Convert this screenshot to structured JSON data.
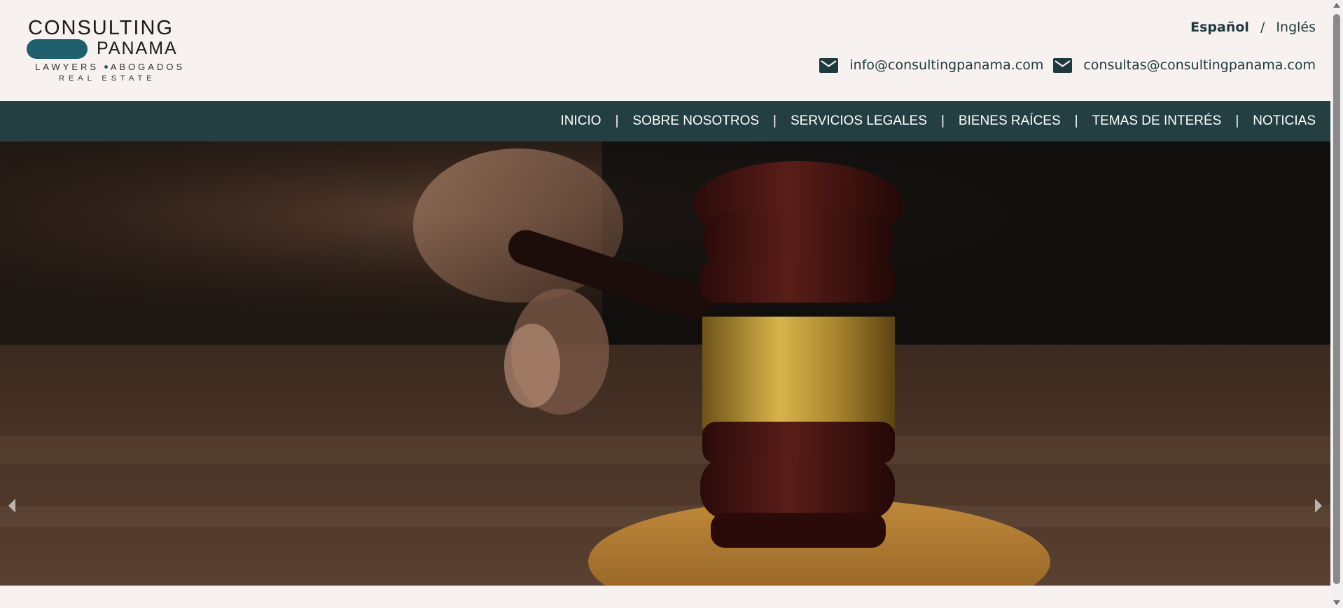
{
  "logo": {
    "line1": "CONSULTING",
    "line2": "PANAMA",
    "tagline_left": "LAWYERS",
    "tagline_right": "ABOGADOS",
    "line3": "REAL ESTATE"
  },
  "language": {
    "spanish": "Español",
    "separator": "/",
    "english": "Inglés"
  },
  "contacts": [
    {
      "icon": "mail-icon",
      "email": "info@consultingpanama.com"
    },
    {
      "icon": "mail-icon",
      "email": "consultas@consultingpanama.com"
    }
  ],
  "nav": {
    "items": [
      "INICIO",
      "SOBRE NOSOTROS",
      "SERVICIOS LEGALES",
      "BIENES RAÍCES",
      "TEMAS DE INTERÉS",
      "NOTICIAS"
    ],
    "separator": "|"
  },
  "hero": {
    "image": "judge-gavel-photo",
    "prev_icon": "arrow-left-icon",
    "next_icon": "arrow-right-icon"
  },
  "colors": {
    "brand": "#1f5f6d",
    "nav_bg": "#243f42",
    "page_bg": "#f7f1f0"
  }
}
